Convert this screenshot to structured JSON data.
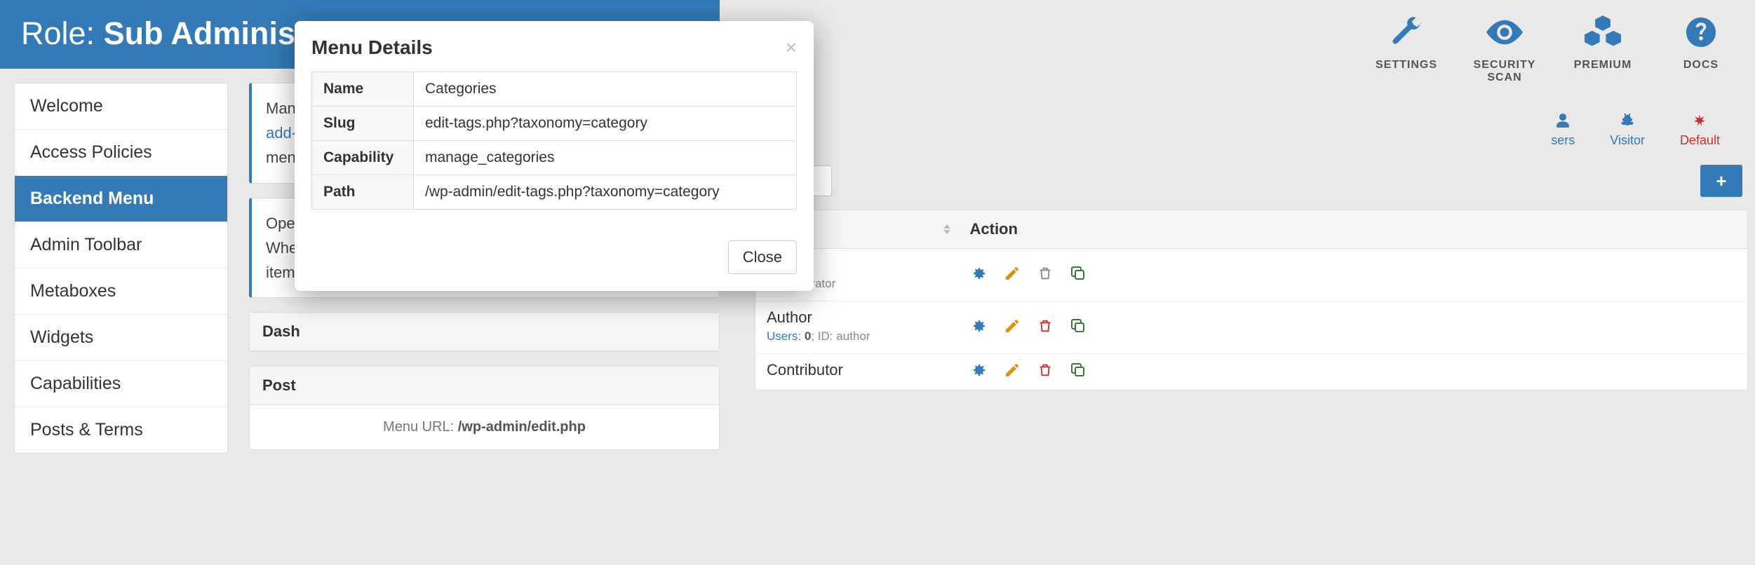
{
  "header": {
    "prefix": "Role: ",
    "role_name": "Sub Administrator"
  },
  "sidebar": {
    "items": [
      {
        "label": "Welcome"
      },
      {
        "label": "Access Policies"
      },
      {
        "label": "Backend Menu",
        "active": true
      },
      {
        "label": "Admin Toolbar"
      },
      {
        "label": "Metaboxes"
      },
      {
        "label": "Widgets"
      },
      {
        "label": "Capabilities"
      },
      {
        "label": "Posts & Terms"
      }
    ]
  },
  "main": {
    "info1_prefix": "Mana",
    "info1_link": "add-",
    "info1_suffix": "menu",
    "info2_line1": "Opera",
    "info2_line2": "When",
    "info2_line3": "items",
    "panels": [
      {
        "title": "Dash"
      },
      {
        "title": "Post"
      }
    ],
    "menu_url_label": "Menu URL: ",
    "menu_url_value": "/wp-admin/edit.php"
  },
  "toolbar": {
    "items": [
      {
        "label": "SETTINGS",
        "icon": "wrench"
      },
      {
        "label": "SECURITY SCAN",
        "icon": "eye"
      },
      {
        "label": "PREMIUM",
        "icon": "cubes"
      },
      {
        "label": "DOCS",
        "icon": "question"
      }
    ]
  },
  "role_tabs": [
    {
      "label": "sers",
      "color": "blue",
      "icon": "user"
    },
    {
      "label": "Visitor",
      "color": "blue",
      "icon": "bug"
    },
    {
      "label": "Default",
      "color": "red",
      "icon": "asterisk"
    }
  ],
  "search": {
    "value": "e",
    "add_label": "+"
  },
  "roles_table": {
    "col_action": "Action",
    "rows": [
      {
        "name_suffix": "ator",
        "meta_suffix": "administrator"
      },
      {
        "name": "Author",
        "users_label": "Users:",
        "users": "0",
        "id_label": "ID:",
        "id": "author",
        "trash_red": true
      },
      {
        "name": "Contributor"
      }
    ]
  },
  "modal": {
    "title": "Menu Details",
    "rows": [
      {
        "label": "Name",
        "value": "Categories"
      },
      {
        "label": "Slug",
        "value": "edit-tags.php?taxonomy=category"
      },
      {
        "label": "Capability",
        "value": "manage_categories"
      },
      {
        "label": "Path",
        "value": "/wp-admin/edit-tags.php?taxonomy=category"
      }
    ],
    "close_label": "Close"
  }
}
